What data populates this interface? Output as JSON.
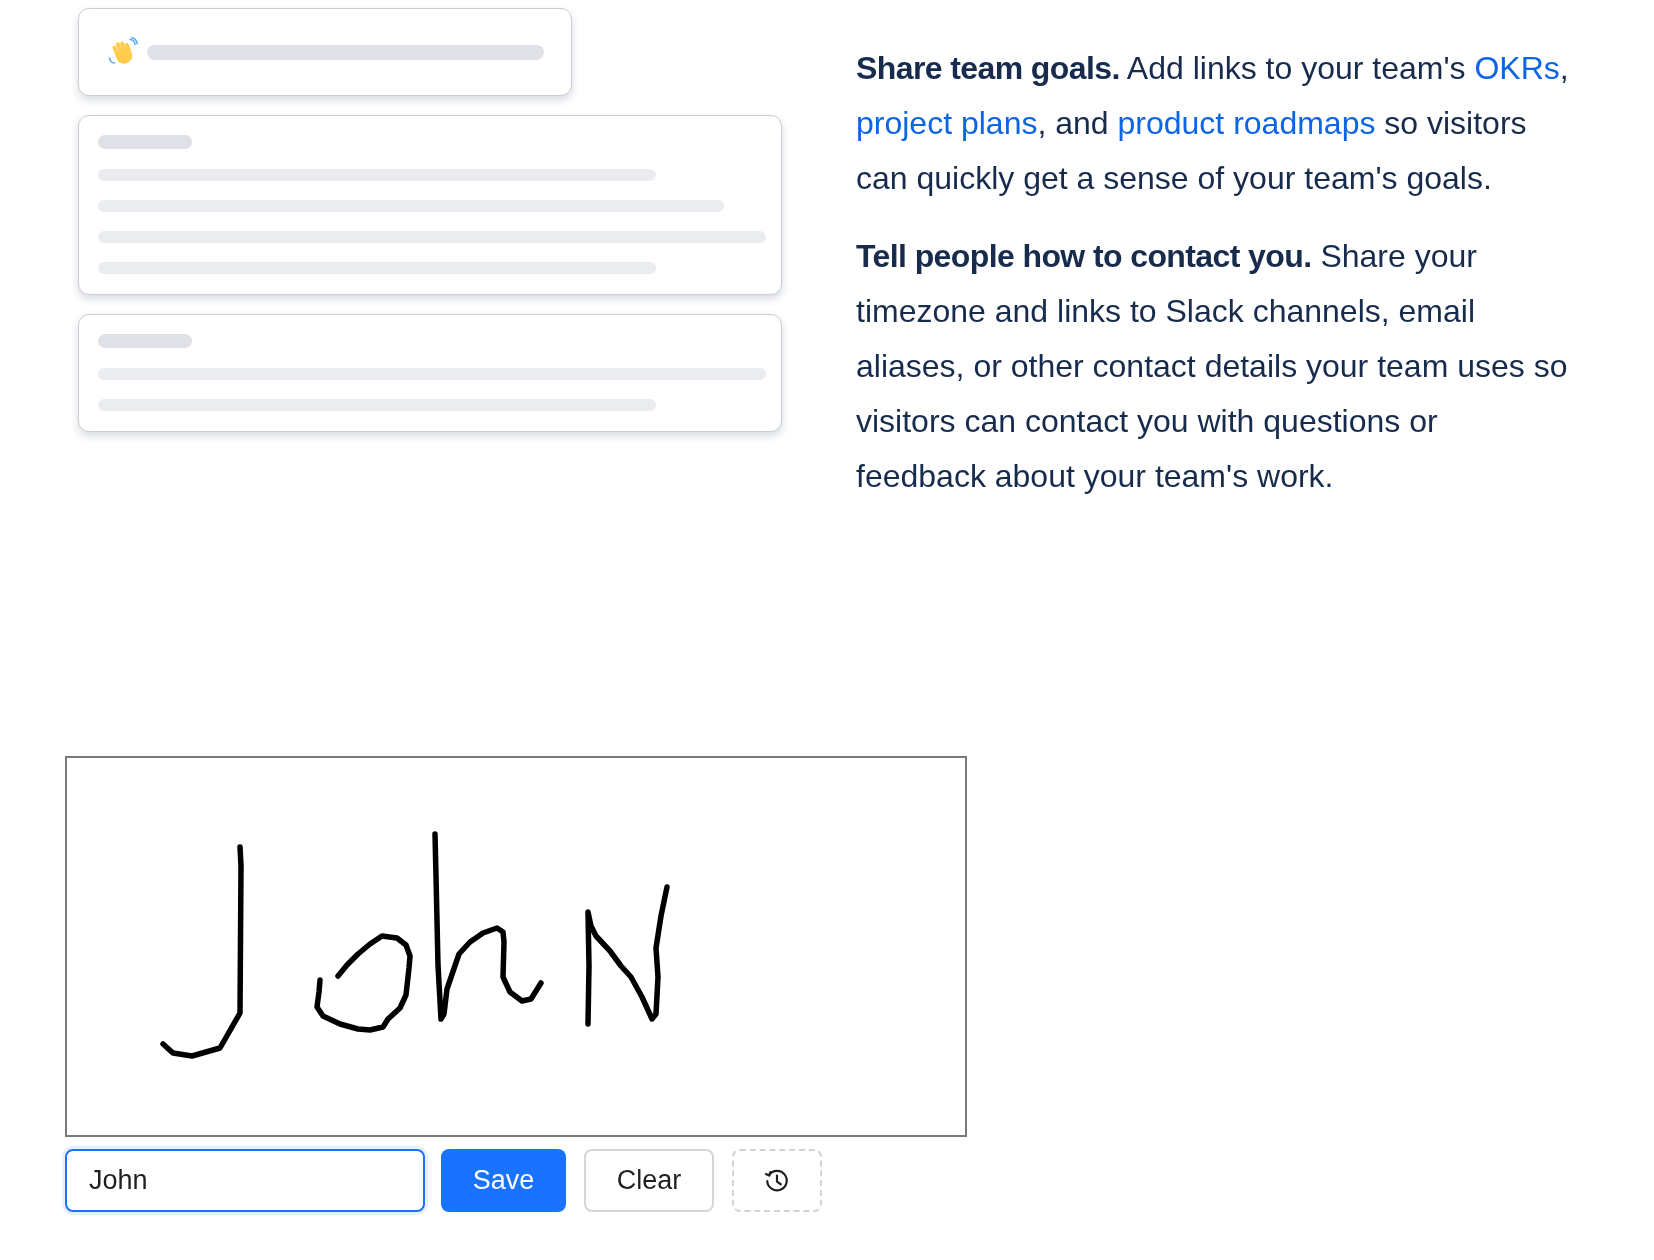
{
  "preview_cards": [
    {
      "kind": "greeting"
    },
    {
      "kind": "detailed"
    },
    {
      "kind": "brief"
    }
  ],
  "tips": [
    {
      "parts": [
        {
          "kind": "text",
          "text": "**Share team goals.** Add links to your team's "
        },
        {
          "kind": "link",
          "text": "OKRs"
        },
        {
          "kind": "text",
          "text": ", "
        },
        {
          "kind": "link",
          "text": "project plans"
        },
        {
          "kind": "text",
          "text": ", and "
        },
        {
          "kind": "link",
          "text": "product roadmaps"
        },
        {
          "kind": "text",
          "text": " so visitors can quickly get a sense of your team's goals."
        }
      ]
    },
    {
      "parts": [
        {
          "kind": "text",
          "text": "**Tell people how to contact you.** Share your timezone and links to Slack channels, email aliases, or other contact details your team uses so visitors can contact you with questions or feedback about your team's work."
        }
      ]
    }
  ],
  "name_field": {
    "value": "John",
    "focused": true
  },
  "buttons": [
    {
      "kind": "primary",
      "label": "Save"
    },
    {
      "kind": "secondary",
      "label": "Clear"
    },
    {
      "kind": "history"
    }
  ]
}
